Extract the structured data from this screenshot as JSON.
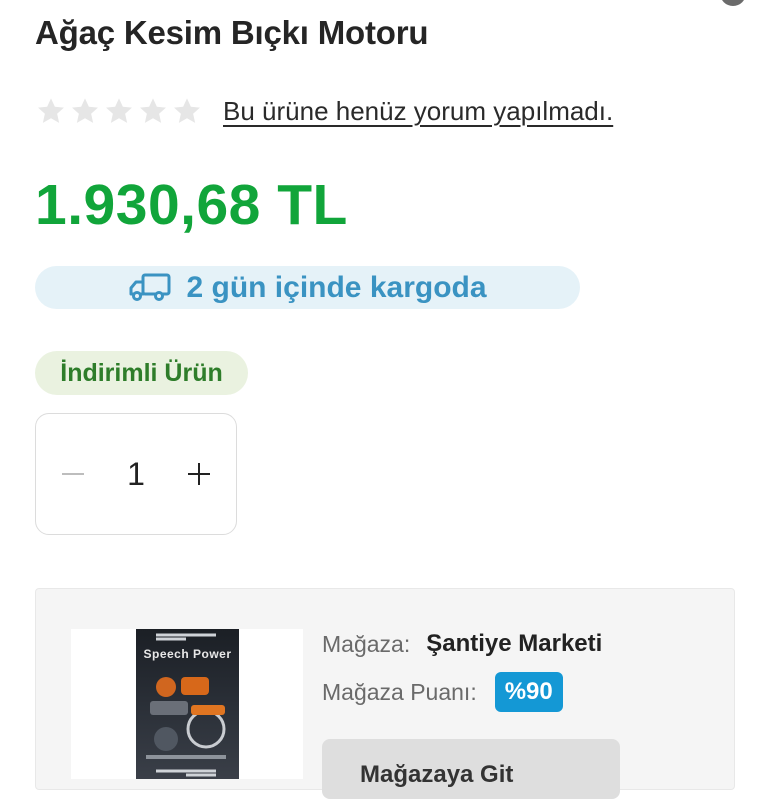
{
  "product": {
    "title": "Ağaç Kesim Bıçkı Motoru",
    "rating": {
      "stars_filled": 0,
      "stars_total": 5,
      "review_text": "Bu ürüne henüz yorum yapılmadı."
    },
    "price": "1.930,68 TL",
    "shipping_text": "2 gün içinde kargoda",
    "discount_badge": "İndirimli Ürün",
    "quantity": "1"
  },
  "store": {
    "store_label": "Mağaza:",
    "store_name": "Şantiye Marketi",
    "score_label": "Mağaza Puanı:",
    "score_value": "%90",
    "thumbnail_brand": "Speech Power",
    "button_label": "Mağazaya Git"
  },
  "icons": {
    "star": "star-icon",
    "truck": "truck-icon",
    "minus": "minus-icon",
    "plus": "plus-icon"
  },
  "colors": {
    "price": "#11a53a",
    "shipping_text": "#3a93c2",
    "shipping_bg": "#e5f2f8",
    "discount_text": "#2e7d2a",
    "discount_bg": "#eaf2e0",
    "score_badge": "#1498d5",
    "star_empty": "#e6e6e6"
  }
}
